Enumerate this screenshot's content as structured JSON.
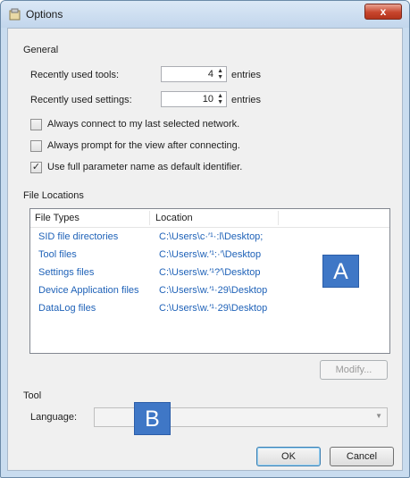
{
  "window": {
    "title": "Options",
    "close_glyph": "x"
  },
  "general": {
    "heading": "General",
    "recent_tools": {
      "label": "Recently used tools:",
      "value": "4",
      "unit": "entries"
    },
    "recent_settings": {
      "label": "Recently used settings:",
      "value": "10",
      "unit": "entries"
    },
    "checkboxes": [
      {
        "label": "Always connect to my last selected network.",
        "checked": false
      },
      {
        "label": "Always prompt for the view after connecting.",
        "checked": false
      },
      {
        "label": "Use full parameter name as default identifier.",
        "checked": true
      }
    ]
  },
  "file_locations": {
    "heading": "File Locations",
    "columns": [
      "File Types",
      "Location"
    ],
    "rows": [
      {
        "type": "SID file directories",
        "location": "C:\\Users\\c·′¹·:l\\Desktop;"
      },
      {
        "type": "Tool files",
        "location": "C:\\Users\\w.′¹:·′\\Desktop"
      },
      {
        "type": "Settings files",
        "location": "C:\\Users\\w.′¹?′\\Desktop"
      },
      {
        "type": "Device Application files",
        "location": "C:\\Users\\w.′¹·29\\Desktop"
      },
      {
        "type": "DataLog files",
        "location": "C:\\Users\\w.′¹·29\\Desktop"
      }
    ],
    "modify_label": "Modify..."
  },
  "tool": {
    "heading": "Tool",
    "language_label": "Language:",
    "language_value": ""
  },
  "buttons": {
    "ok": "OK",
    "cancel": "Cancel"
  },
  "callouts": {
    "a": "A",
    "b": "B"
  },
  "colors": {
    "link": "#1f62b8",
    "callout": "#3f77c6",
    "close": "#c8452d"
  }
}
